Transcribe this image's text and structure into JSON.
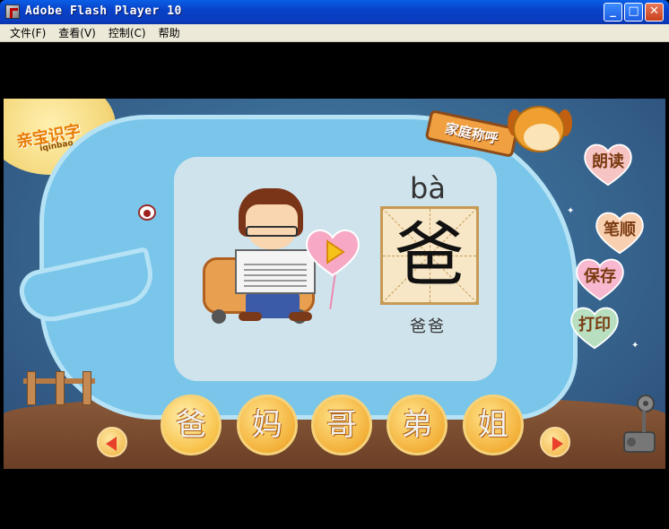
{
  "window": {
    "title": "Adobe Flash Player 10",
    "controls": {
      "minimize": "_",
      "maximize": "□",
      "close": "✕"
    }
  },
  "menu": [
    "文件(F)",
    "查看(V)",
    "控制(C)",
    "帮助"
  ],
  "logo": {
    "text": "亲宝识字",
    "url": "iqinbao.com"
  },
  "section_tag": "家庭称呼",
  "lesson": {
    "pinyin": "bà",
    "character": "爸",
    "word": "爸爸"
  },
  "side_buttons": [
    "朗读",
    "笔顺",
    "保存",
    "打印"
  ],
  "characters": [
    "爸",
    "妈",
    "哥",
    "弟",
    "姐"
  ],
  "colors": {
    "accent": "#f0a040",
    "arrow": "#e8402a",
    "heart": "#f7a8c4"
  }
}
